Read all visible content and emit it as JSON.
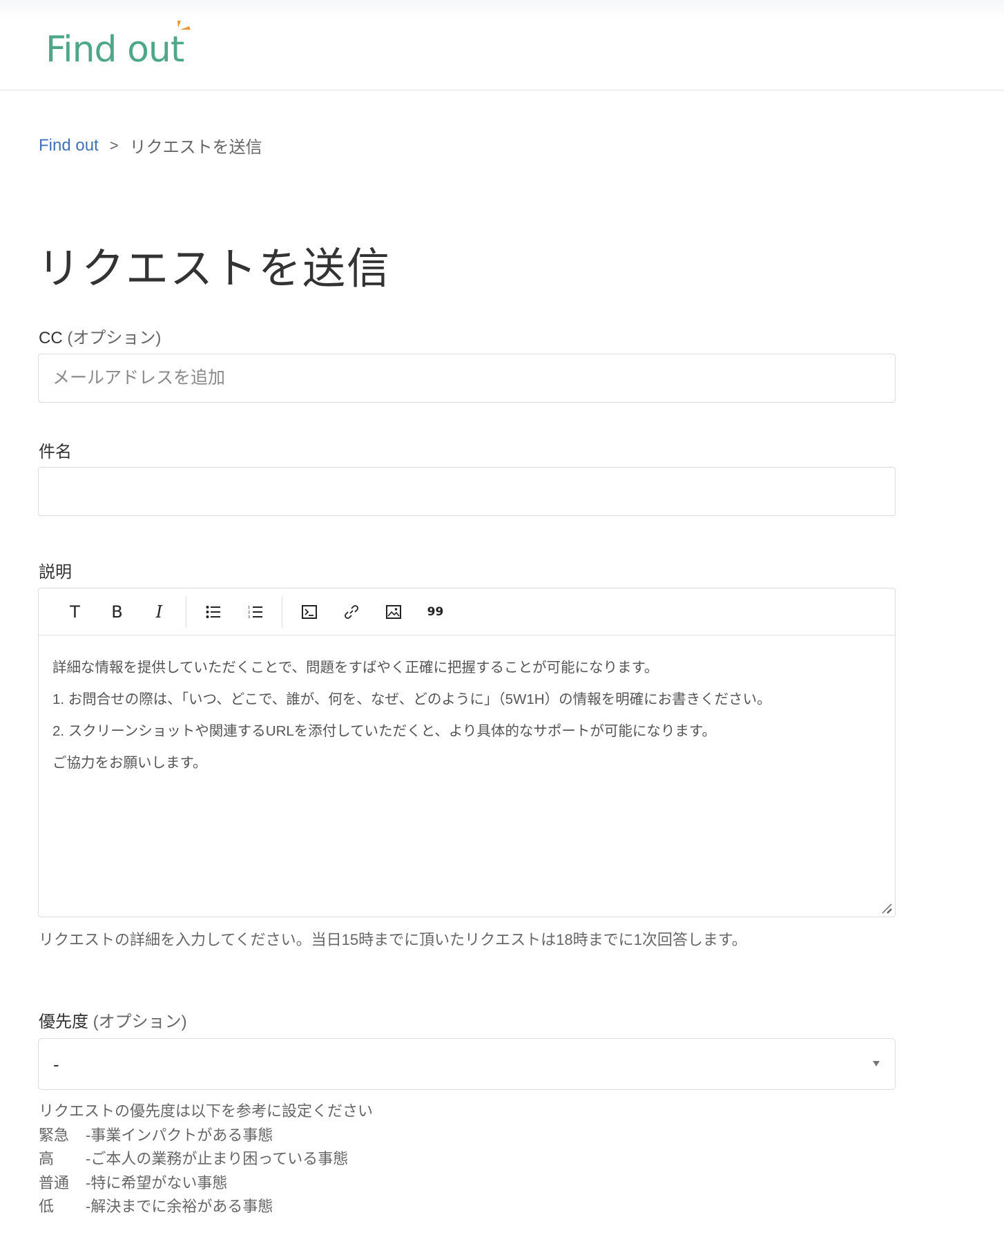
{
  "header": {
    "logo_text": "Find out",
    "brand_color": "#4fa78a",
    "accent_color": "#e8973a"
  },
  "breadcrumb": {
    "home": "Find out",
    "separator": ">",
    "current": "リクエストを送信"
  },
  "page": {
    "title": "リクエストを送信"
  },
  "form": {
    "cc": {
      "label": "CC",
      "optional": "(オプション)",
      "value": "",
      "placeholder": "メールアドレスを追加"
    },
    "subject": {
      "label": "件名",
      "value": ""
    },
    "description": {
      "label": "説明",
      "toolbar": [
        {
          "name": "text-format",
          "glyph": "T"
        },
        {
          "name": "bold",
          "glyph": "B"
        },
        {
          "name": "italic",
          "glyph": "I"
        },
        {
          "name": "bulleted-list",
          "glyph": ""
        },
        {
          "name": "numbered-list",
          "glyph": ""
        },
        {
          "name": "code-block",
          "glyph": ""
        },
        {
          "name": "link",
          "glyph": ""
        },
        {
          "name": "image",
          "glyph": ""
        },
        {
          "name": "quote",
          "glyph": "99"
        }
      ],
      "content": [
        "詳細な情報を提供していただくことで、問題をすばやく正確に把握することが可能になります。",
        "1. お問合せの際は、「いつ、どこで、誰が、何を、なぜ、どのように」（5W1H）の情報を明確にお書きください。",
        "2. スクリーンショットや関連するURLを添付していただくと、より具体的なサポートが可能になります。",
        "ご協力をお願いします。"
      ],
      "hint": "リクエストの詳細を入力してください。当日15時までに頂いたリクエストは18時までに1次回答します。"
    },
    "priority": {
      "label": "優先度",
      "optional": "(オプション)",
      "selected": "-",
      "help_title": "リクエストの優先度は以下を参考に設定ください",
      "levels": [
        {
          "level": "緊急",
          "desc": "-事業インパクトがある事態"
        },
        {
          "level": "高",
          "desc": "-ご本人の業務が止まり困っている事態"
        },
        {
          "level": "普通",
          "desc": "-特に希望がない事態"
        },
        {
          "level": "低",
          "desc": "-解決までに余裕がある事態"
        }
      ]
    }
  }
}
